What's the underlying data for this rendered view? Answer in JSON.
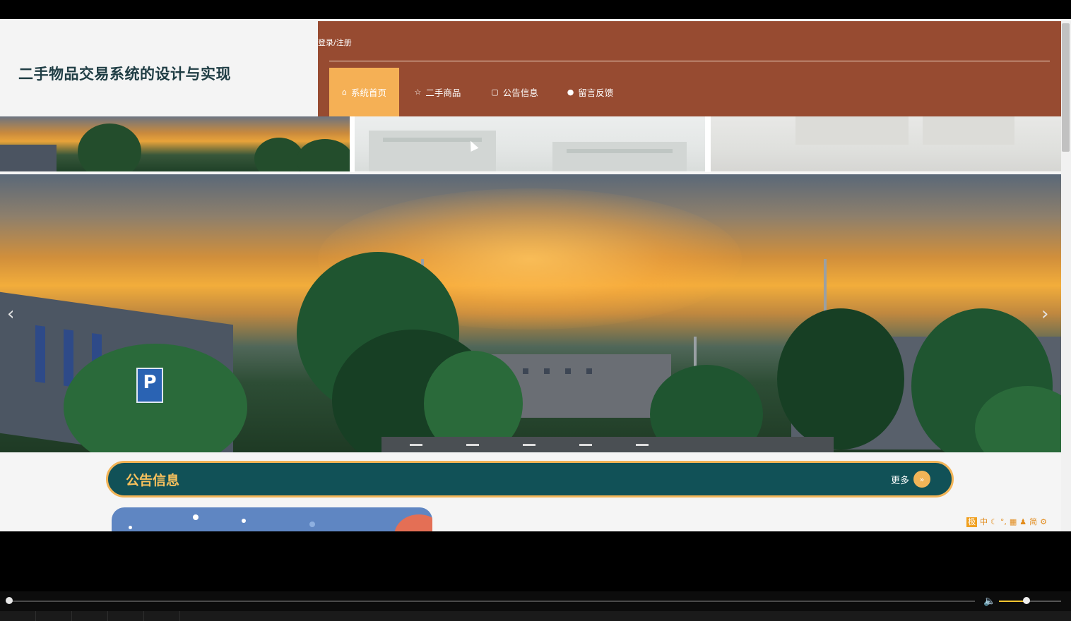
{
  "brand": {
    "title": "二手物品交易系统的设计与实现"
  },
  "topbar": {
    "login_label": "登录/注册"
  },
  "nav": {
    "items": [
      {
        "label": "系统首页",
        "icon": "home-icon",
        "active": true
      },
      {
        "label": "二手商品",
        "icon": "star-icon",
        "active": false
      },
      {
        "label": "公告信息",
        "icon": "bag-icon",
        "active": false
      },
      {
        "label": "留言反馈",
        "icon": "info-icon",
        "active": false
      }
    ]
  },
  "carousel": {
    "prev_icon": "chevron-left-icon",
    "next_icon": "chevron-right-icon",
    "prev_glyph": "‹",
    "next_glyph": "›",
    "parking_sign": "P"
  },
  "section": {
    "title": "公告信息",
    "more_label": "更多",
    "more_glyph": "»"
  },
  "ime": {
    "items": [
      "极",
      "中",
      "☾",
      "°,",
      "▦",
      "♟",
      "简",
      "⚙"
    ]
  },
  "player": {
    "volume_glyph": "🔈"
  },
  "colors": {
    "topbar": "#974b31",
    "nav_active": "#f5b055",
    "section_bg": "#115157",
    "section_border": "#f2b457",
    "section_title": "#f7c15d",
    "brand_title": "#1f3d44"
  }
}
